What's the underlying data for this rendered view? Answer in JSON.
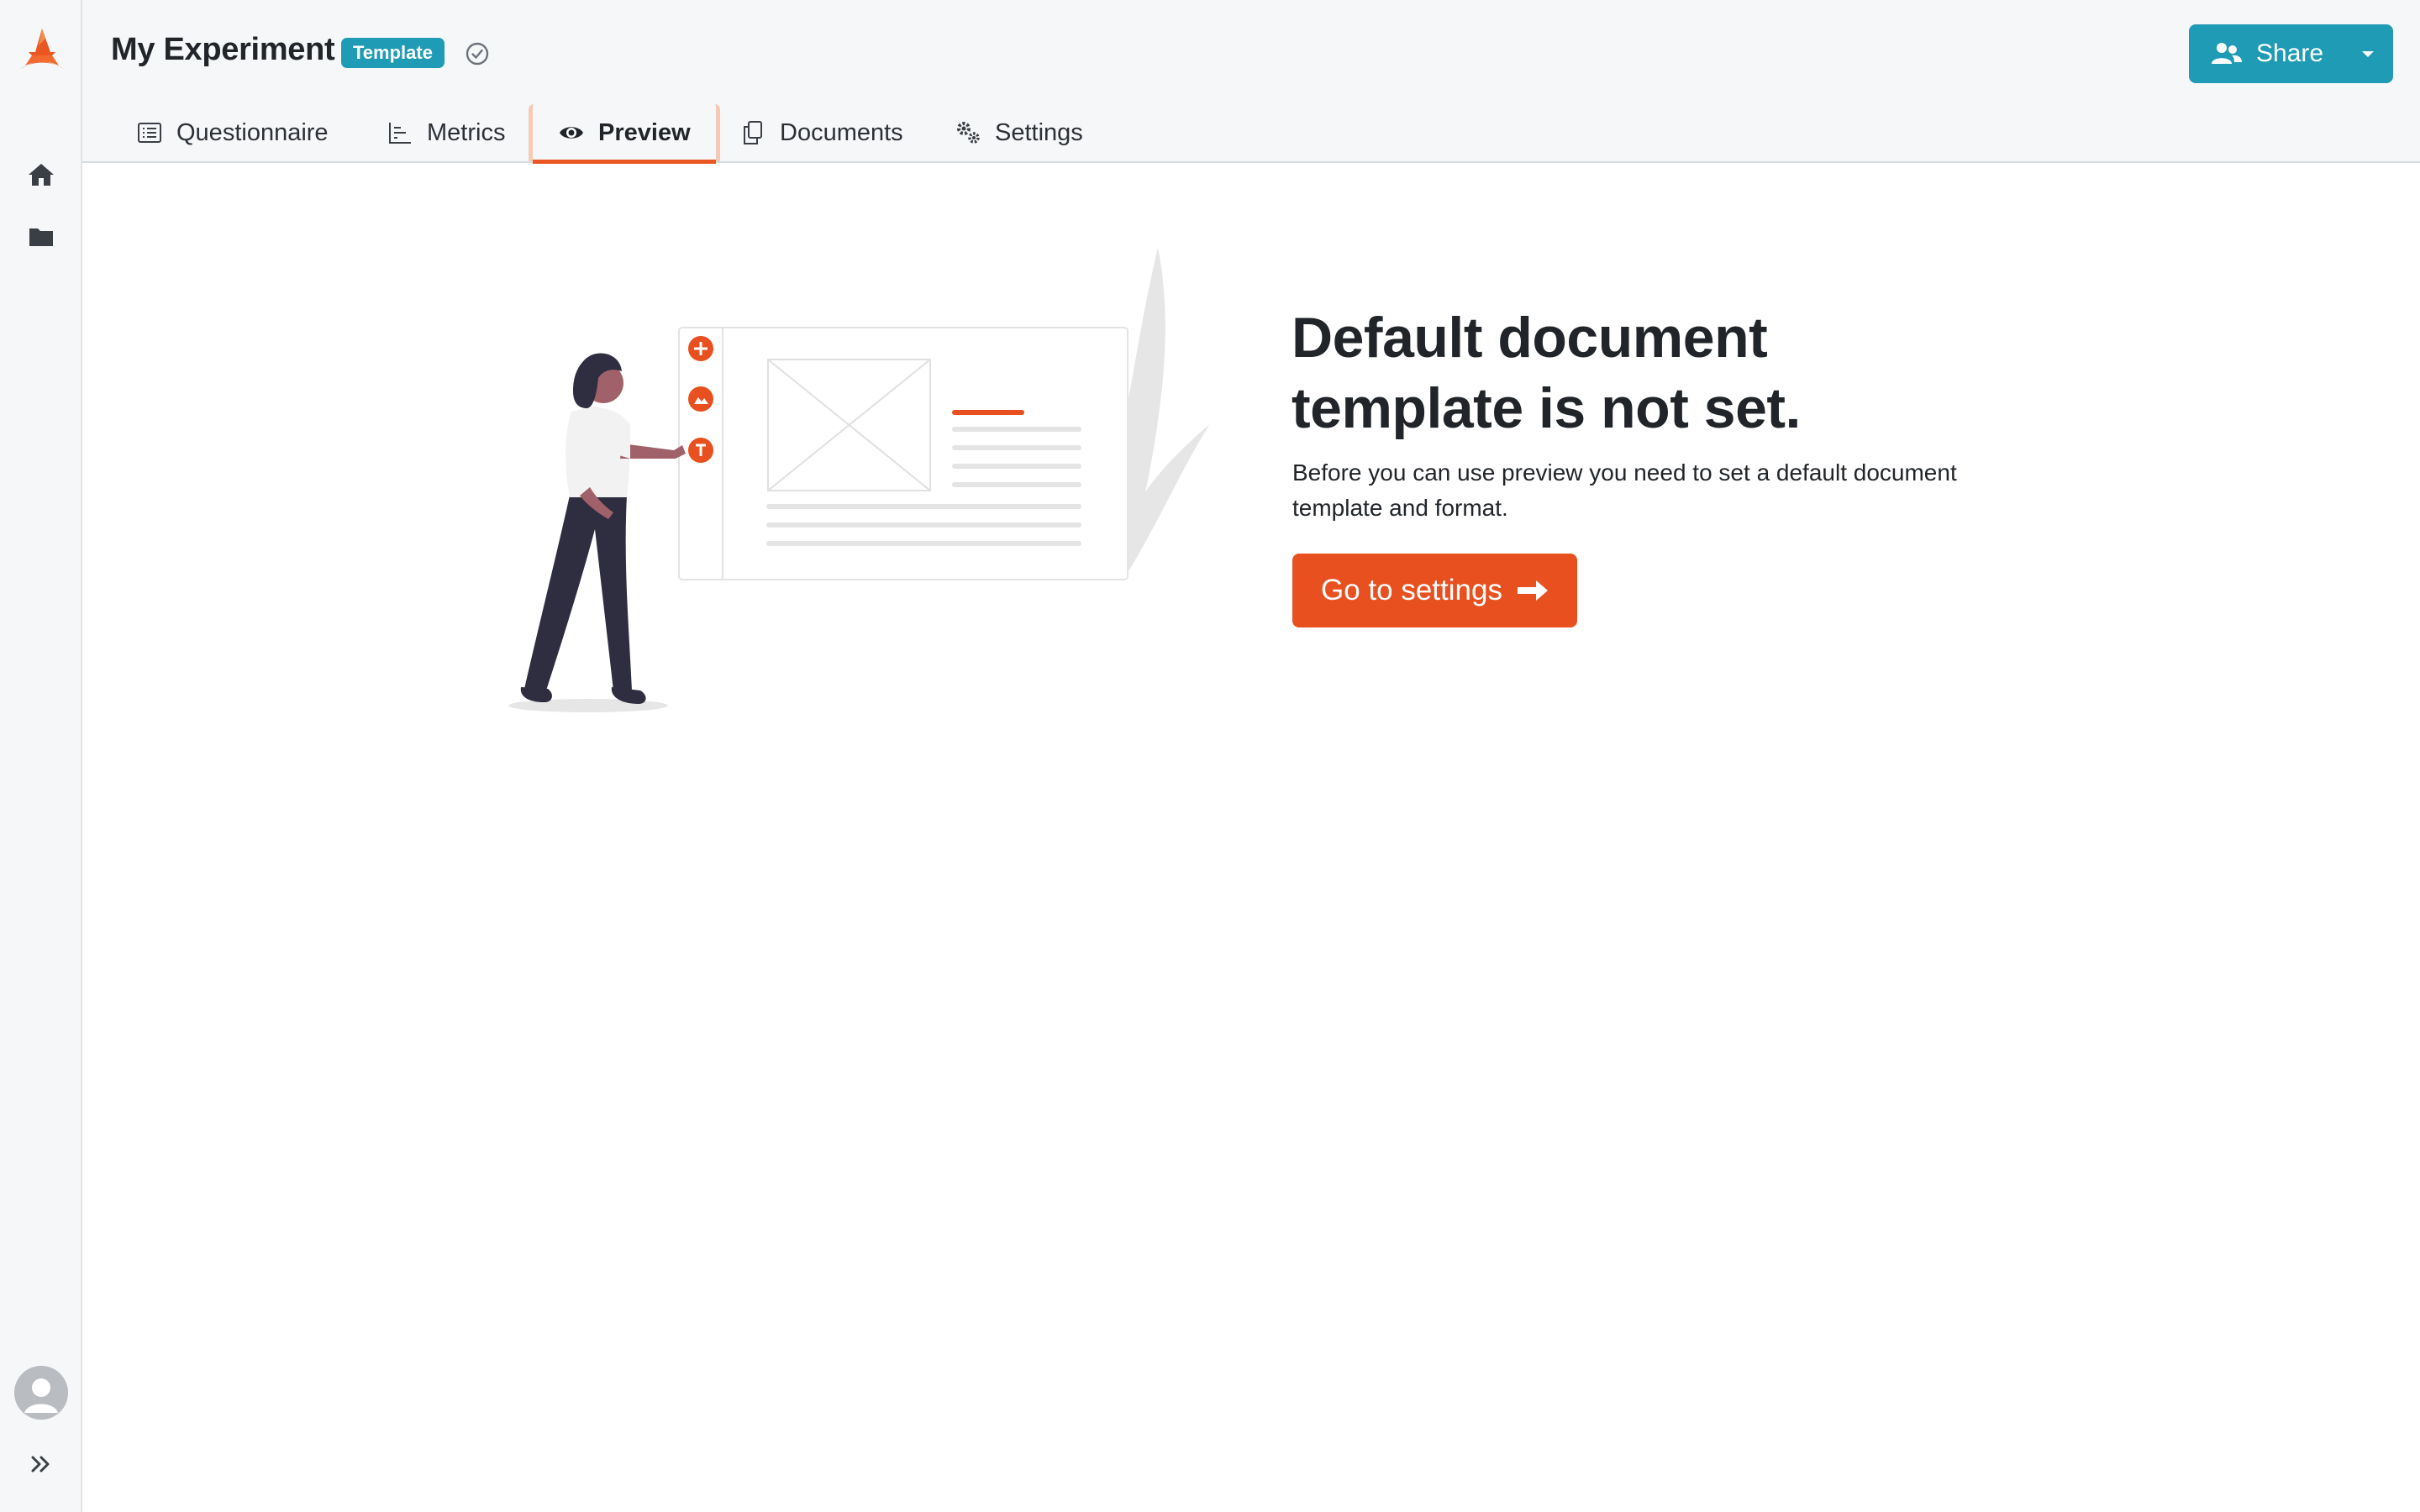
{
  "app": {
    "logo_icon": "wizard-hat-logo-icon"
  },
  "rail": {
    "items": [
      {
        "icon": "home-icon"
      },
      {
        "icon": "folder-icon"
      }
    ],
    "avatar_icon": "user-avatar-icon",
    "expand_icon": "double-chevron-right-icon"
  },
  "header": {
    "title": "My Experiment",
    "badge": "Template",
    "status_icon": "check-circle-icon",
    "share_label": "Share"
  },
  "tabs": [
    {
      "label": "Questionnaire",
      "icon": "list-icon",
      "active": false
    },
    {
      "label": "Metrics",
      "icon": "chart-icon",
      "active": false
    },
    {
      "label": "Preview",
      "icon": "eye-icon",
      "active": true
    },
    {
      "label": "Documents",
      "icon": "copy-icon",
      "active": false
    },
    {
      "label": "Settings",
      "icon": "gears-icon",
      "active": false
    }
  ],
  "main": {
    "heading": "Default document template is not set.",
    "description": "Before you can use preview you need to set a default document template and format.",
    "button_label": "Go to settings",
    "button_icon": "arrow-right-icon"
  },
  "colors": {
    "accent": "#e8501f",
    "primary": "#1f9bb5",
    "sidebar_bg": "#f6f7f9"
  }
}
